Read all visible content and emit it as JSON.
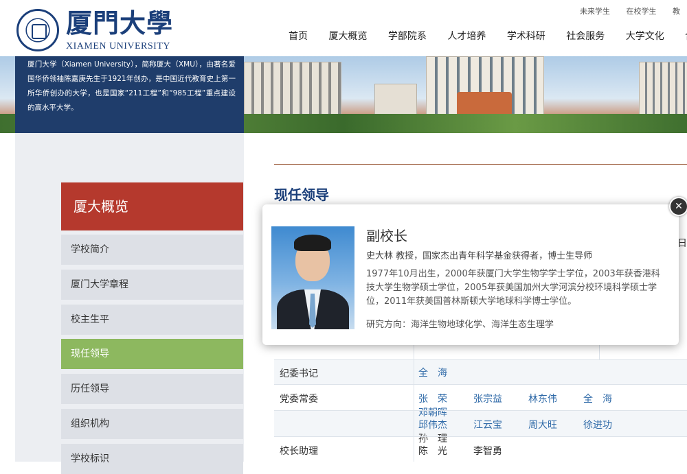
{
  "header": {
    "logo_cn": "厦門大學",
    "logo_en": "XIAMEN UNIVERSITY",
    "top_links": [
      "未来学生",
      "在校学生",
      "教"
    ],
    "nav": [
      "首页",
      "厦大概览",
      "学部院系",
      "人才培养",
      "学术科研",
      "社会服务",
      "大学文化",
      "合"
    ]
  },
  "banner": {
    "intro": "厦门大学（Xiamen University），简称厦大（XMU），由著名爱国华侨领袖陈嘉庚先生于1921年创办，是中国近代教育史上第一所华侨创办的大学，也是国家“211工程”和“985工程”重点建设的高水平大学。"
  },
  "sidebar": {
    "title": "厦大概览",
    "items": [
      {
        "label": "学校简介",
        "active": false
      },
      {
        "label": "厦门大学章程",
        "active": false
      },
      {
        "label": "校主生平",
        "active": false
      },
      {
        "label": "现任领导",
        "active": true
      },
      {
        "label": "历任领导",
        "active": false
      },
      {
        "label": "组织机构",
        "active": false
      },
      {
        "label": "学校标识",
        "active": false
      }
    ]
  },
  "content": {
    "title": "现任领导",
    "edge_char": "日",
    "rows": [
      {
        "role": "纪委书记",
        "names": [
          "全　海"
        ]
      },
      {
        "role": "党委常委",
        "names": [
          "张　荣",
          "张宗益",
          "林东伟",
          "全　海",
          "邓朝晖"
        ]
      },
      {
        "role": "",
        "names": [
          "邱伟杰",
          "江云宝",
          "周大旺",
          "徐进功",
          "孙　理"
        ]
      },
      {
        "role": "校长助理",
        "names": [
          "陈　光",
          "李智勇"
        ]
      }
    ]
  },
  "popup": {
    "title": "副校长",
    "subtitle": "史大林 教授，国家杰出青年科学基金获得者，博士生导师",
    "bio": "1977年10月出生，2000年获厦门大学生物学学士学位，2003年获香港科技大学生物学硕士学位，2005年获美国加州大学河滨分校环境科学硕士学位，2011年获美国普林斯顿大学地球科学博士学位。",
    "research": "研究方向：海洋生物地球化学、海洋生态生理学",
    "close_glyph": "✕"
  }
}
